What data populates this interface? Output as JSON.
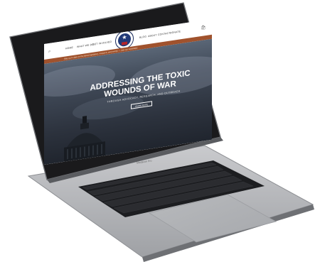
{
  "device": {
    "model_label": "MacBook Pro"
  },
  "colors": {
    "banner": "#a0522d",
    "nav_bg": "#ffffff",
    "hero_dark": "#2c323d",
    "logo_blue": "#223a78",
    "logo_red": "#b4242a"
  },
  "site": {
    "nav": {
      "left_items": [
        "HOME",
        "WHAT WE DO",
        "GET INVOLVED"
      ],
      "right_items": [
        "BLOG",
        "ABOUT",
        "CONTACT",
        "DONATE"
      ]
    },
    "banner_text": "Stay up to date on the latest legislation, research, and events — Join our newsletter",
    "hero": {
      "title": "ADDRESSING THE TOXIC WOUNDS OF WAR",
      "subtitle": "THROUGH ADVOCACY, RESEARCH, AND OUTREACH",
      "button_label": "LEARN MORE"
    },
    "section_title": "ADDRESSING THE TOXIC WOUNDS OF WAR"
  }
}
